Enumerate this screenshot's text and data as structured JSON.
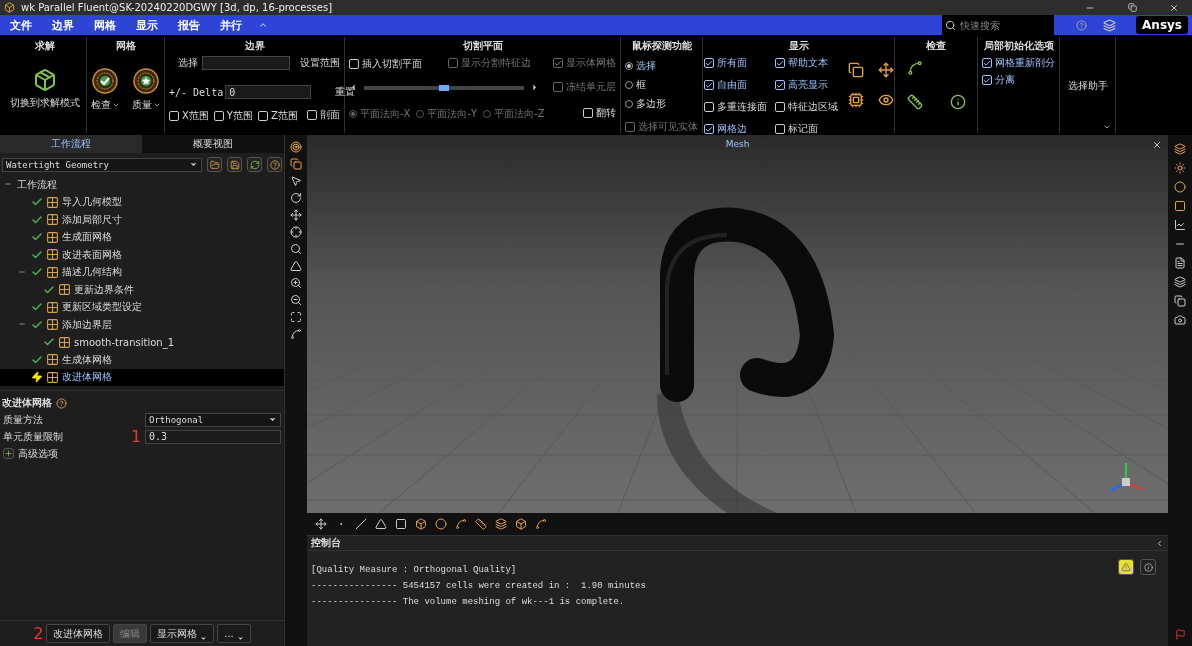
{
  "window": {
    "title": "wk Parallel Fluent@SK-20240220DGWY  [3d, dp, 16-processes]"
  },
  "menu": [
    "文件",
    "边界",
    "网格",
    "显示",
    "报告",
    "并行"
  ],
  "search": {
    "placeholder": "快速搜索"
  },
  "brand": "Ansys",
  "ribbon": {
    "solve": {
      "title": "求解",
      "button": "切换到求解模式"
    },
    "mesh": {
      "title": "网格",
      "buttons": [
        "检查",
        "质量"
      ]
    },
    "boundary": {
      "title": "边界",
      "select_label": "选择",
      "set_range": "设置范围",
      "delta_label": "+/- Delta",
      "delta_value": "0",
      "reset": "重置",
      "ranges": [
        {
          "label": "X范围",
          "checked": false
        },
        {
          "label": "Y范围",
          "checked": false
        },
        {
          "label": "Z范围",
          "checked": false
        }
      ],
      "section": {
        "label": "剖面",
        "checked": false
      }
    },
    "cut_plane": {
      "title": "切割平面",
      "insert": {
        "label": "插入切割平面",
        "checked": false,
        "disabled": false
      },
      "show_edges": {
        "label": "显示分割特征边",
        "checked": false,
        "disabled": true
      },
      "show_mesh": {
        "label": "显示体网格",
        "checked": true,
        "disabled": true
      },
      "freeze": {
        "label": "冻结单元层",
        "checked": false,
        "disabled": true
      },
      "slider": {
        "level": 0.5
      },
      "normals": [
        {
          "label": "平面法向-X",
          "selected": true
        },
        {
          "label": "平面法向-Y",
          "selected": false
        },
        {
          "label": "平面法向-Z",
          "selected": false
        }
      ],
      "flip": {
        "label": "翻转",
        "checked": false,
        "disabled": false
      }
    },
    "probe": {
      "title": "鼠标探测功能",
      "modes": [
        {
          "label": "选择",
          "selected": true
        },
        {
          "label": "框",
          "selected": false
        },
        {
          "label": "多边形",
          "selected": false
        }
      ],
      "visible_only": {
        "label": "选择可见实体",
        "checked": false,
        "disabled": true
      }
    },
    "display": {
      "title": "显示",
      "options": [
        {
          "label": "所有面",
          "checked": true
        },
        {
          "label": "帮助文本",
          "checked": true
        },
        {
          "label": "自由面",
          "checked": true
        },
        {
          "label": "高亮显示",
          "checked": true
        },
        {
          "label": "多重连接面",
          "checked": false
        },
        {
          "label": "特征边区域",
          "checked": false
        },
        {
          "label": "网格边",
          "checked": true
        },
        {
          "label": "标记面",
          "checked": false
        }
      ]
    },
    "check": {
      "title": "检查"
    },
    "local_init": {
      "title": "局部初始化选项",
      "options": [
        {
          "label": "网格重新剖分",
          "checked": true
        },
        {
          "label": "分离",
          "checked": true
        }
      ]
    },
    "selection_helper": "选择助手"
  },
  "left_panel": {
    "tabs": [
      {
        "label": "工作流程",
        "selected": true
      },
      {
        "label": "概要视图",
        "selected": false
      }
    ],
    "workflow": "Watertight Geometry",
    "tree": [
      {
        "label": "工作流程",
        "expanded": true,
        "children": [
          {
            "label": "导入几何模型",
            "done": true,
            "selected": false
          },
          {
            "label": "添加局部尺寸",
            "done": true,
            "selected": false
          },
          {
            "label": "生成面网格",
            "done": true,
            "selected": false
          },
          {
            "label": "改进表面网格",
            "done": true,
            "selected": false
          },
          {
            "label": "描述几何结构",
            "done": true,
            "selected": false,
            "expanded": true,
            "children": [
              {
                "label": "更新边界条件",
                "done": true,
                "selected": false
              }
            ]
          },
          {
            "label": "更新区域类型设定",
            "done": true,
            "selected": false
          },
          {
            "label": "添加边界层",
            "done": true,
            "selected": false,
            "expanded": true,
            "children": [
              {
                "label": "smooth-transition_1",
                "done": true,
                "selected": false
              }
            ]
          },
          {
            "label": "生成体网格",
            "done": true,
            "selected": false
          },
          {
            "label": "改进体网格",
            "done": false,
            "selected": true
          }
        ]
      }
    ],
    "properties": {
      "title": "改进体网格",
      "fields": [
        {
          "label": "质量方法",
          "kind": "select",
          "value": "Orthogonal"
        },
        {
          "label": "单元质量限制",
          "kind": "input",
          "value": "0.3",
          "marker": "1"
        }
      ],
      "advanced": {
        "label": "高级选项",
        "expanded": false
      }
    },
    "footer": {
      "marker": "2",
      "buttons": [
        {
          "label": "改进体网格",
          "kind": "button",
          "disabled": false
        },
        {
          "label": "编辑",
          "kind": "button",
          "disabled": true
        },
        {
          "label": "显示网格",
          "kind": "menu",
          "disabled": false
        },
        {
          "label": "...",
          "kind": "menu",
          "disabled": false
        }
      ]
    }
  },
  "viewport": {
    "title": "Mesh"
  },
  "console": {
    "title": "控制台",
    "lines": [
      "[Quality Measure : Orthogonal Quality]",
      "---------------- 5454157 cells were created in :  1.90 minutes",
      "---------------- The volume meshing of wk---1 is complete."
    ]
  }
}
